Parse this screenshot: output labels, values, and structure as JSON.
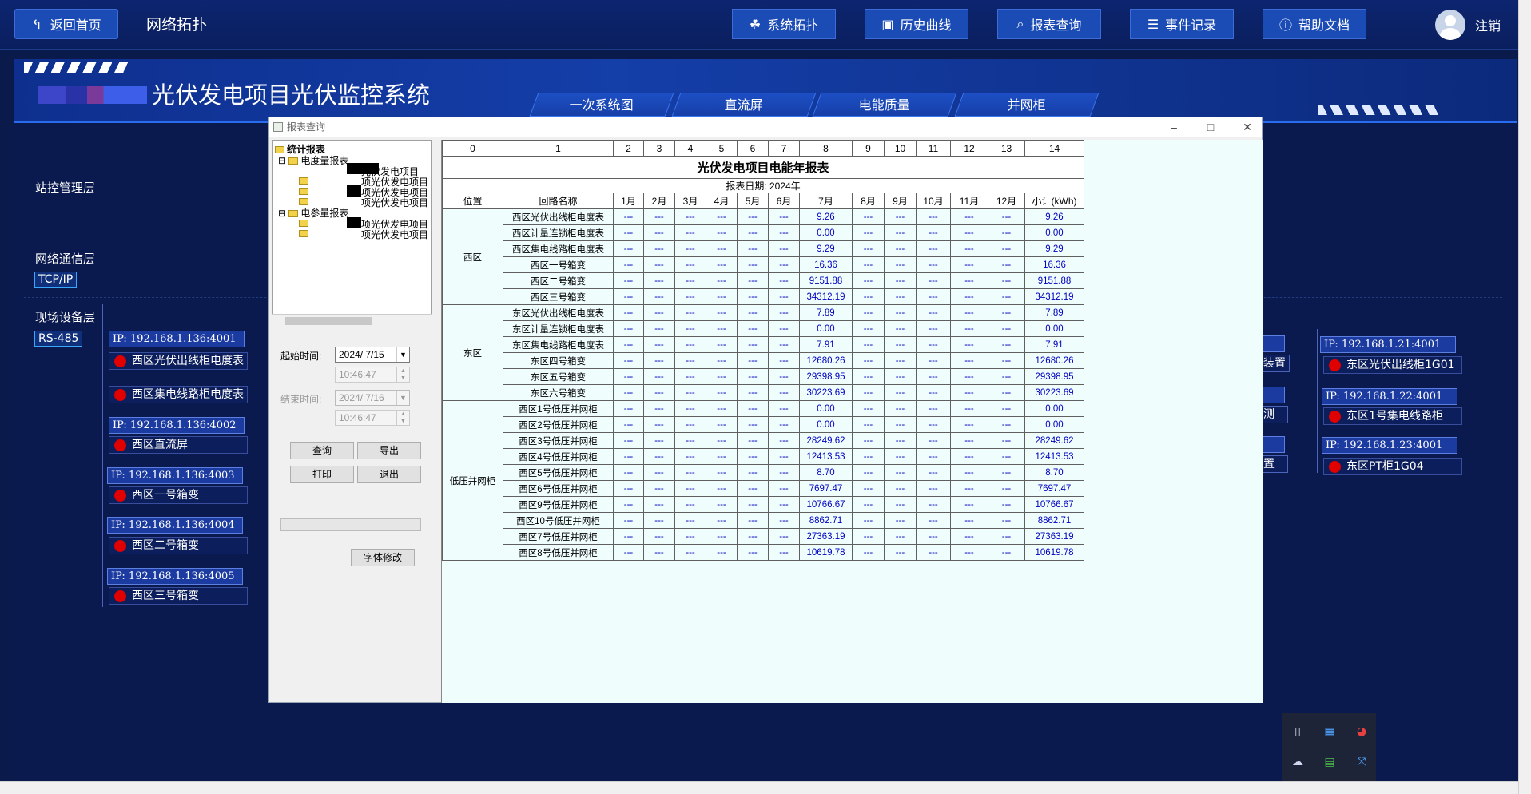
{
  "topbar": {
    "back_label": "返回首页",
    "page_title": "网络拓扑",
    "nav": [
      "系统拓扑",
      "历史曲线",
      "报表查询",
      "事件记录",
      "帮助文档"
    ],
    "logout_label": "注销"
  },
  "banner": {
    "system_title": "光伏发电项目光伏监控系统",
    "tabs": [
      "一次系统图",
      "直流屏",
      "电能质量",
      "并网柜"
    ]
  },
  "layers": {
    "station": "站控管理层",
    "network": "网络通信层",
    "network_tag": "TCP/IP",
    "field": "现场设备层",
    "field_tag": "RS-485"
  },
  "left_devices": [
    {
      "ip": "IP: 192.168.1.136:4001",
      "names": [
        "西区光伏出线柜电度表",
        "西区集电线路柜电度表"
      ]
    },
    {
      "ip": "IP: 192.168.1.136:4002",
      "names": [
        "西区直流屏"
      ]
    },
    {
      "ip": "IP: 192.168.1.136:4003",
      "names": [
        "西区一号箱变"
      ]
    },
    {
      "ip": "IP: 192.168.1.136:4004",
      "names": [
        "西区二号箱变"
      ]
    },
    {
      "ip": "IP: 192.168.1.136:4005",
      "names": [
        "西区三号箱变"
      ]
    }
  ],
  "right_partial": [
    "装置",
    "测",
    "置"
  ],
  "right_devices": [
    {
      "ip": "IP: 192.168.1.21:4001",
      "name": "东区光伏出线柜1G01"
    },
    {
      "ip": "IP: 192.168.1.22:4001",
      "name": "东区1号集电线路柜"
    },
    {
      "ip": "IP: 192.168.1.23:4001",
      "name": "东区PT柜1G04"
    }
  ],
  "dialog": {
    "title": "报表查询",
    "tree": {
      "root": "统计报表",
      "group1": "电度量报表",
      "group1_items": [
        "光伏发电项目",
        "项光伏发电项目",
        "项光伏发电项目",
        "项光伏发电项目"
      ],
      "group2": "电参量报表",
      "group2_items": [
        "项光伏发电项目",
        "项光伏发电项目"
      ]
    },
    "start_label": "起始时间:",
    "start_date": "2024/ 7/15",
    "start_time": "10:46:47",
    "end_label": "结束时间:",
    "end_date": "2024/ 7/16",
    "end_time": "10:46:47",
    "buttons": {
      "query": "查询",
      "export": "导出",
      "print": "打印",
      "exit": "退出",
      "font": "字体修改"
    }
  },
  "report": {
    "col_index": [
      "0",
      "1",
      "2",
      "3",
      "4",
      "5",
      "6",
      "7",
      "8",
      "9",
      "10",
      "11",
      "12",
      "13",
      "14"
    ],
    "title": "光伏发电项目电能年报表",
    "date_line": "报表日期: 2024年",
    "headers": [
      "位置",
      "回路名称",
      "1月",
      "2月",
      "3月",
      "4月",
      "5月",
      "6月",
      "7月",
      "8月",
      "9月",
      "10月",
      "11月",
      "12月",
      "小计(kWh)"
    ],
    "empty": "---",
    "groups": [
      {
        "location": "西区",
        "rows": [
          {
            "name": "西区光伏出线柜电度表",
            "jul": "9.26",
            "total": "9.26"
          },
          {
            "name": "西区计量连锁柜电度表",
            "jul": "0.00",
            "total": "0.00"
          },
          {
            "name": "西区集电线路柜电度表",
            "jul": "9.29",
            "total": "9.29"
          },
          {
            "name": "西区一号箱变",
            "jul": "16.36",
            "total": "16.36"
          },
          {
            "name": "西区二号箱变",
            "jul": "9151.88",
            "total": "9151.88"
          },
          {
            "name": "西区三号箱变",
            "jul": "34312.19",
            "total": "34312.19"
          }
        ]
      },
      {
        "location": "东区",
        "rows": [
          {
            "name": "东区光伏出线柜电度表",
            "jul": "7.89",
            "total": "7.89"
          },
          {
            "name": "东区计量连锁柜电度表",
            "jul": "0.00",
            "total": "0.00"
          },
          {
            "name": "东区集电线路柜电度表",
            "jul": "7.91",
            "total": "7.91"
          },
          {
            "name": "东区四号箱变",
            "jul": "12680.26",
            "total": "12680.26"
          },
          {
            "name": "东区五号箱变",
            "jul": "29398.95",
            "total": "29398.95"
          },
          {
            "name": "东区六号箱变",
            "jul": "30223.69",
            "total": "30223.69"
          }
        ]
      },
      {
        "location": "低压并网柜",
        "rows": [
          {
            "name": "西区1号低压并网柜",
            "jul": "0.00",
            "total": "0.00"
          },
          {
            "name": "西区2号低压并网柜",
            "jul": "0.00",
            "total": "0.00"
          },
          {
            "name": "西区3号低压并网柜",
            "jul": "28249.62",
            "total": "28249.62"
          },
          {
            "name": "西区4号低压并网柜",
            "jul": "12413.53",
            "total": "12413.53"
          },
          {
            "name": "西区5号低压并网柜",
            "jul": "8.70",
            "total": "8.70"
          },
          {
            "name": "西区6号低压并网柜",
            "jul": "7697.47",
            "total": "7697.47"
          },
          {
            "name": "西区9号低压并网柜",
            "jul": "10766.67",
            "total": "10766.67"
          },
          {
            "name": "西区10号低压并网柜",
            "jul": "8862.71",
            "total": "8862.71"
          },
          {
            "name": "西区7号低压并网柜",
            "jul": "27363.19",
            "total": "27363.19"
          },
          {
            "name": "西区8号低压并网柜",
            "jul": "10619.78",
            "total": "10619.78"
          }
        ]
      }
    ]
  }
}
